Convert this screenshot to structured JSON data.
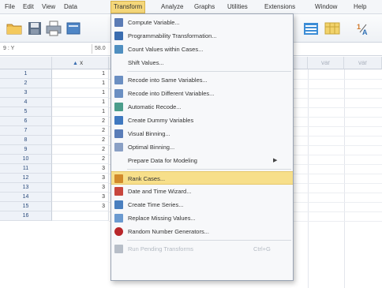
{
  "menubar": {
    "items": [
      {
        "label": "File"
      },
      {
        "label": "Edit"
      },
      {
        "label": "View"
      },
      {
        "label": "Data"
      },
      {
        "label": "Transform"
      },
      {
        "label": "Analyze"
      },
      {
        "label": "Graphs"
      },
      {
        "label": "Utilities"
      },
      {
        "label": "Extensions"
      },
      {
        "label": "Window"
      },
      {
        "label": "Help"
      }
    ],
    "active_index": 4
  },
  "refbar": {
    "cell_ref": "9 : Y",
    "cell_value": "58.0"
  },
  "grid": {
    "headers": {
      "x": "x",
      "var1": "var",
      "var2": "var"
    },
    "rows": [
      {
        "n": "1",
        "x": "1"
      },
      {
        "n": "2",
        "x": "1"
      },
      {
        "n": "3",
        "x": "1"
      },
      {
        "n": "4",
        "x": "1"
      },
      {
        "n": "5",
        "x": "1"
      },
      {
        "n": "6",
        "x": "2"
      },
      {
        "n": "7",
        "x": "2"
      },
      {
        "n": "8",
        "x": "2"
      },
      {
        "n": "9",
        "x": "2"
      },
      {
        "n": "10",
        "x": "2"
      },
      {
        "n": "11",
        "x": "3"
      },
      {
        "n": "12",
        "x": "3"
      },
      {
        "n": "13",
        "x": "3"
      },
      {
        "n": "14",
        "x": "3"
      },
      {
        "n": "15",
        "x": "3"
      },
      {
        "n": "16",
        "x": ""
      }
    ]
  },
  "transform_menu": {
    "items": [
      {
        "label": "Compute Variable...",
        "icon": "calculator-icon",
        "color": "#5a7bb5"
      },
      {
        "label": "Programmability Transformation...",
        "icon": "program-icon",
        "color": "#3a6db0"
      },
      {
        "label": "Count Values within Cases...",
        "icon": "count-icon",
        "color": "#4f8fc0"
      },
      {
        "label": "Shift Values...",
        "icon": "",
        "color": ""
      },
      {
        "label": "Recode into Same Variables...",
        "icon": "recode-same-icon",
        "color": "#6b8fc2"
      },
      {
        "label": "Recode into Different Variables...",
        "icon": "recode-different-icon",
        "color": "#6b8fc2"
      },
      {
        "label": "Automatic Recode...",
        "icon": "auto-recode-icon",
        "color": "#4b9d8b"
      },
      {
        "label": "Create Dummy Variables",
        "icon": "dummy-icon",
        "color": "#3f78c0"
      },
      {
        "label": "Visual Binning...",
        "icon": "binning-icon",
        "color": "#5a7db8"
      },
      {
        "label": "Optimal Binning...",
        "icon": "optimal-binning-icon",
        "color": "#8aa0c5"
      },
      {
        "label": "Prepare Data for Modeling",
        "icon": "",
        "color": "",
        "submenu": true
      },
      {
        "label": "Rank Cases...",
        "icon": "rank-icon",
        "color": "#d28a2b",
        "highlight": true
      },
      {
        "label": "Date and Time Wizard...",
        "icon": "calendar-icon",
        "color": "#c8463d"
      },
      {
        "label": "Create Time Series...",
        "icon": "time-series-icon",
        "color": "#4a7fbf"
      },
      {
        "label": "Replace Missing Values...",
        "icon": "replace-missing-icon",
        "color": "#6b9ad0"
      },
      {
        "label": "Random Number Generators...",
        "icon": "dice-icon",
        "color": "#b8262a"
      },
      {
        "label": "Run Pending Transforms",
        "icon": "run-icon",
        "color": "#b7bec8",
        "disabled": true,
        "shortcut": "Ctrl+G"
      }
    ]
  }
}
